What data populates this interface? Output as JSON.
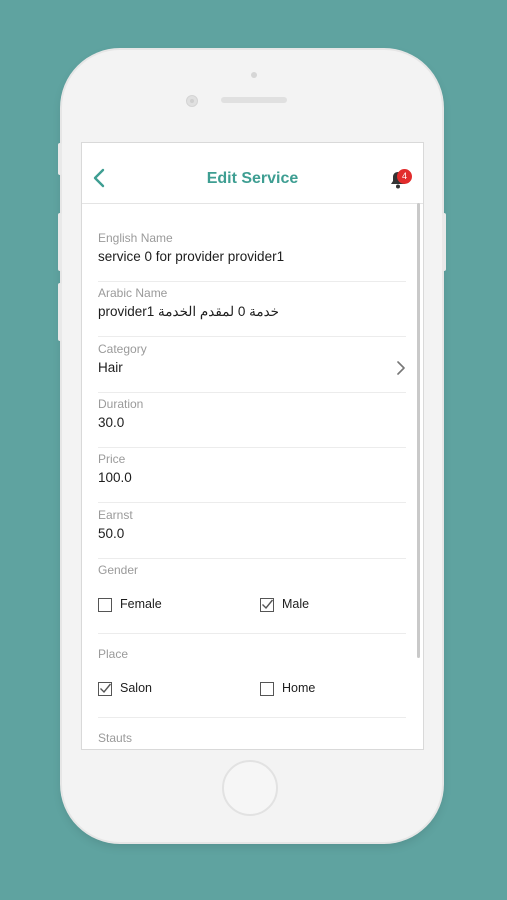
{
  "header": {
    "title": "Edit Service",
    "notification_count": "4"
  },
  "form": {
    "english_name": {
      "label": "English Name",
      "value": "service 0 for provider provider1"
    },
    "arabic_name": {
      "label": "Arabic Name",
      "value": "خدمة 0 لمقدم الخدمة provider1"
    },
    "category": {
      "label": "Category",
      "value": "Hair"
    },
    "duration": {
      "label": "Duration",
      "value": "30.0"
    },
    "price": {
      "label": "Price",
      "value": "100.0"
    },
    "earnst": {
      "label": "Earnst",
      "value": "50.0"
    },
    "gender": {
      "label": "Gender",
      "options": [
        {
          "label": "Female",
          "checked": false
        },
        {
          "label": "Male",
          "checked": true
        }
      ]
    },
    "place": {
      "label": "Place",
      "options": [
        {
          "label": "Salon",
          "checked": true
        },
        {
          "label": "Home",
          "checked": false
        }
      ]
    },
    "status": {
      "label": "Stauts"
    }
  },
  "colors": {
    "background": "#5fa3a0",
    "accent": "#3e9e92",
    "badge": "#e22c2c"
  },
  "icons": {
    "back": "chevron-left-icon",
    "notifications": "bell-icon",
    "category_arrow": "chevron-right-icon"
  }
}
